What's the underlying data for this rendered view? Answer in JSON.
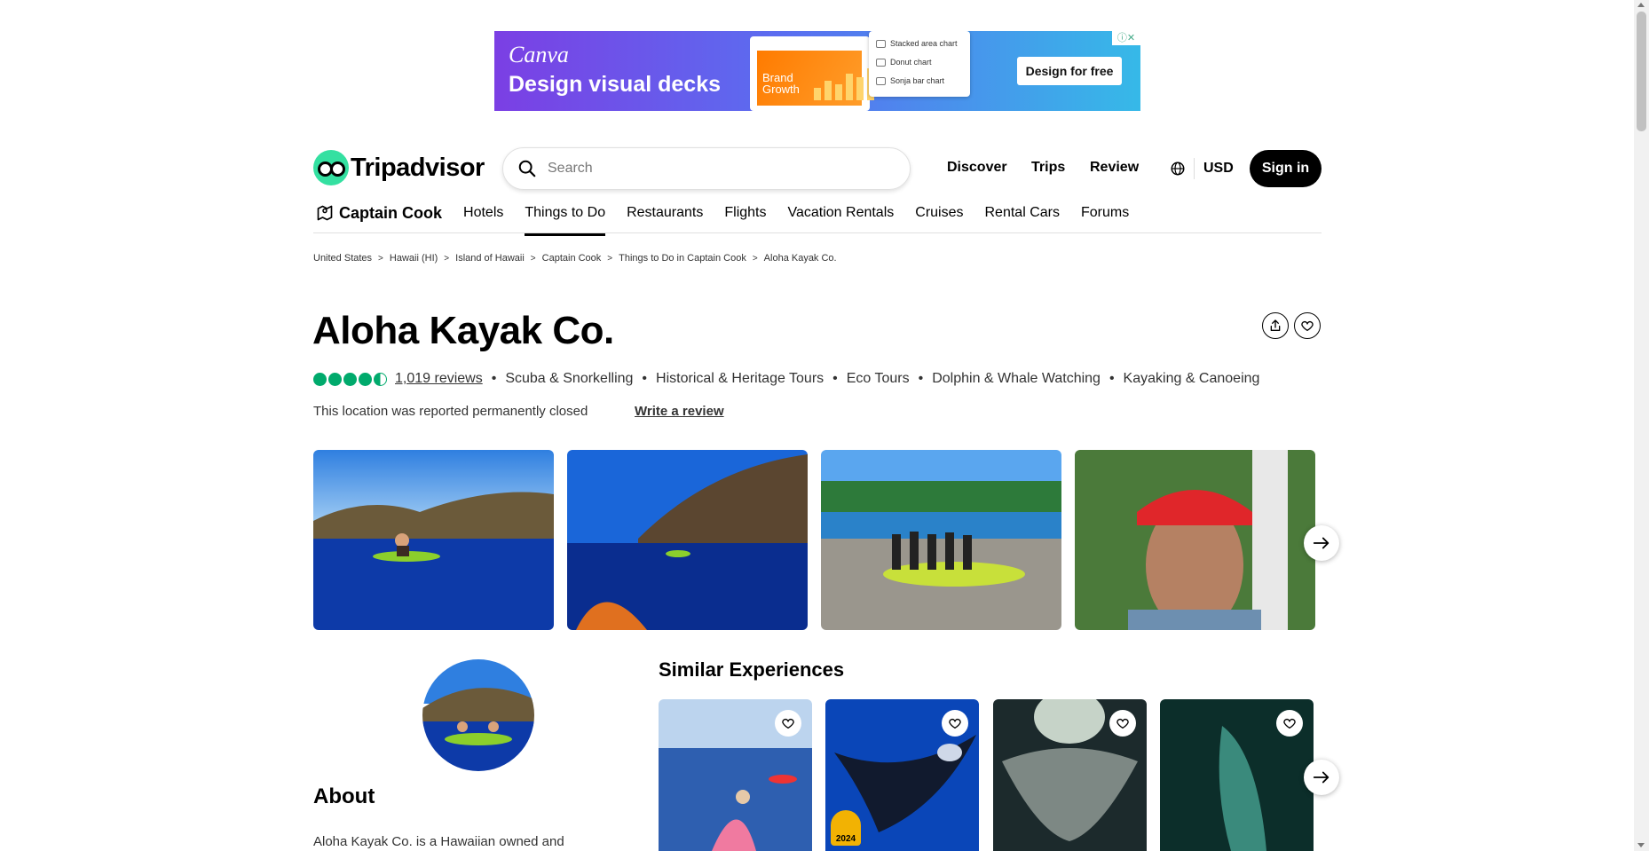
{
  "ad": {
    "brand": "Canva",
    "headline": "Design visual decks",
    "card_text": "Brand Growth",
    "menu_items": [
      "Stacked area chart",
      "Donut chart",
      "Sonja bar chart"
    ],
    "cta": "Design for free"
  },
  "header": {
    "logo_text": "Tripadvisor",
    "search_placeholder": "Search",
    "nav": [
      "Discover",
      "Trips",
      "Review"
    ],
    "currency": "USD",
    "sign_in": "Sign in"
  },
  "category_nav": {
    "location": "Captain Cook",
    "items": [
      "Hotels",
      "Things to Do",
      "Restaurants",
      "Flights",
      "Vacation Rentals",
      "Cruises",
      "Rental Cars",
      "Forums"
    ],
    "active": "Things to Do"
  },
  "breadcrumb": [
    "United States",
    "Hawaii (HI)",
    "Island of Hawaii",
    "Captain Cook",
    "Things to Do in Captain Cook",
    "Aloha Kayak Co."
  ],
  "listing": {
    "title": "Aloha Kayak Co.",
    "rating": 4.5,
    "reviews": "1,019 reviews",
    "categories": [
      "Scuba & Snorkelling",
      "Historical & Heritage Tours",
      "Eco Tours",
      "Dolphin & Whale Watching",
      "Kayaking & Canoeing"
    ],
    "status": "This location was reported permanently closed",
    "write_review": "Write a review"
  },
  "about": {
    "heading": "About",
    "text": "Aloha Kayak Co. is a Hawaiian owned and"
  },
  "similar": {
    "heading": "Similar Experiences",
    "award_year": "2024"
  },
  "colors": {
    "brand_green": "#34e0a1",
    "bubble_green": "#00aa6c",
    "award_gold": "#f2b203"
  }
}
